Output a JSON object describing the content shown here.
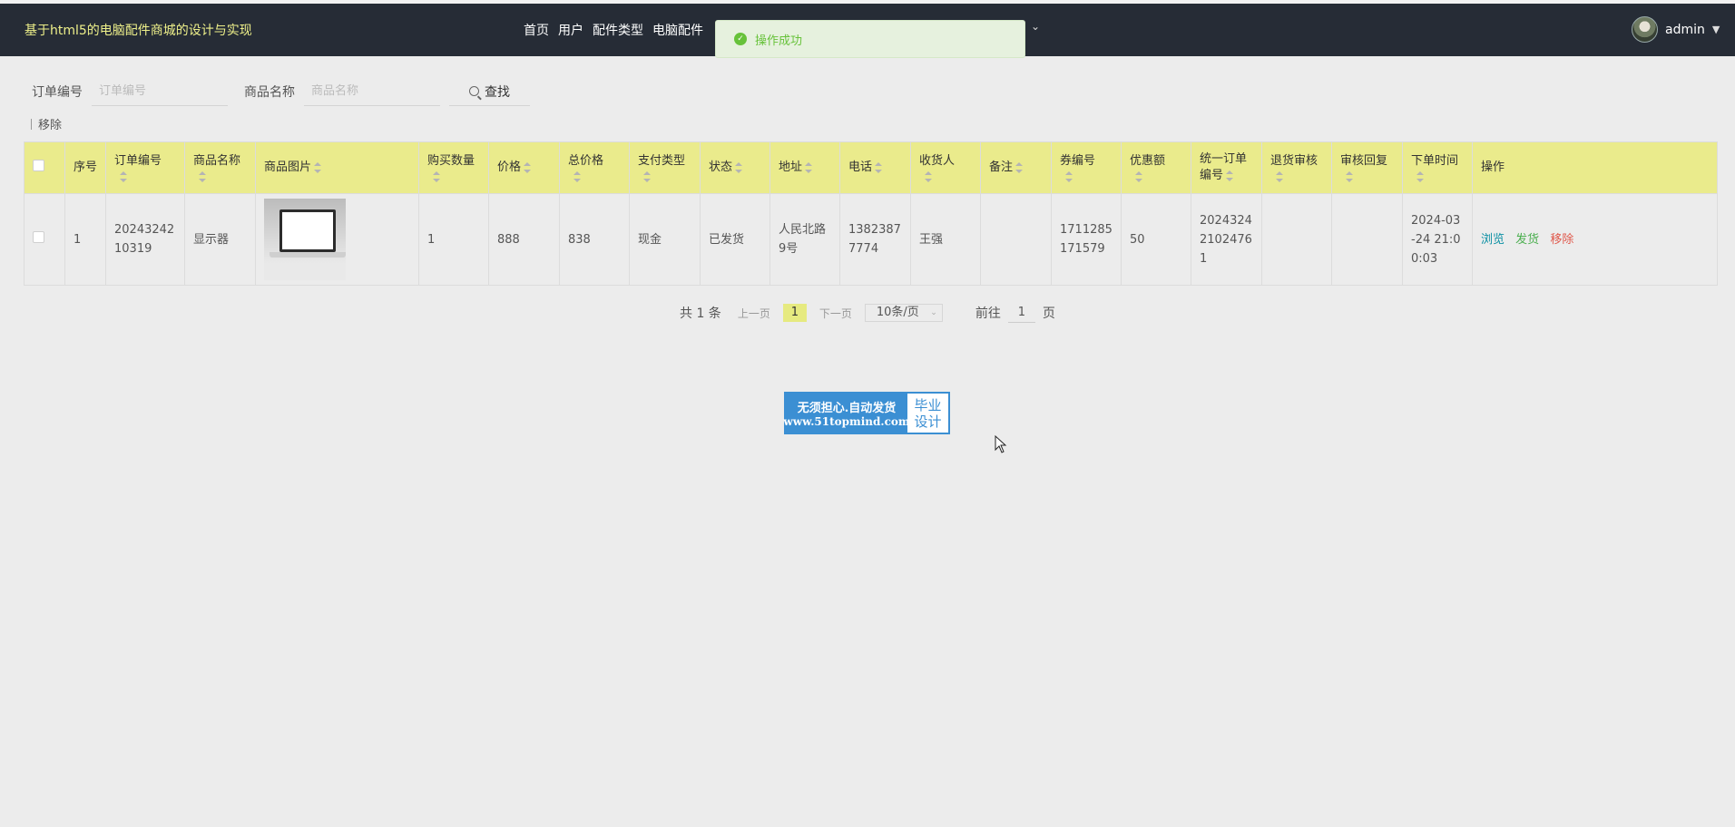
{
  "app": {
    "title": "基于html5的电脑配件商城的设计与实现"
  },
  "nav": {
    "items": [
      "首页",
      "用户",
      "配件类型",
      "电脑配件"
    ],
    "more_caret": "⌄"
  },
  "user": {
    "name": "admin"
  },
  "toast": {
    "message": "操作成功"
  },
  "search": {
    "order_no_label": "订单编号",
    "order_no_placeholder": "订单编号",
    "order_no_value": "",
    "product_label": "商品名称",
    "product_placeholder": "商品名称",
    "product_value": "",
    "button_label": "查找"
  },
  "toolbar": {
    "remove_label": "移除"
  },
  "table": {
    "columns": [
      {
        "key": "index",
        "label": "序号"
      },
      {
        "key": "order_no",
        "label": "订单编号"
      },
      {
        "key": "product",
        "label": "商品名称"
      },
      {
        "key": "image",
        "label": "商品图片"
      },
      {
        "key": "qty",
        "label": "购买数量"
      },
      {
        "key": "price",
        "label": "价格"
      },
      {
        "key": "total",
        "label": "总价格"
      },
      {
        "key": "pay_type",
        "label": "支付类型"
      },
      {
        "key": "status",
        "label": "状态"
      },
      {
        "key": "address",
        "label": "地址"
      },
      {
        "key": "phone",
        "label": "电话"
      },
      {
        "key": "receiver",
        "label": "收货人"
      },
      {
        "key": "remark",
        "label": "备注"
      },
      {
        "key": "coupon_no",
        "label": "券编号"
      },
      {
        "key": "discount",
        "label": "优惠额"
      },
      {
        "key": "unified_order_no",
        "label": "统一订单编号"
      },
      {
        "key": "refund_review",
        "label": "退货审核"
      },
      {
        "key": "review_reply",
        "label": "审核回复"
      },
      {
        "key": "order_time",
        "label": "下单时间"
      },
      {
        "key": "actions",
        "label": "操作"
      }
    ],
    "rows": [
      {
        "index": "1",
        "order_no": "2024324210319",
        "product": "显示器",
        "qty": "1",
        "price": "888",
        "total": "838",
        "pay_type": "现金",
        "status": "已发货",
        "address": "人民北路9号",
        "phone": "13823877774",
        "receiver": "王强",
        "remark": "",
        "coupon_no": "1711285171579",
        "discount": "50",
        "unified_order_no": "202432421024761",
        "refund_review": "",
        "review_reply": "",
        "order_time": "2024-03-24 21:00:03",
        "actions": {
          "view": "浏览",
          "ship": "发货",
          "remove": "移除"
        }
      }
    ]
  },
  "pagination": {
    "total": "共 1 条",
    "prev": "上一页",
    "current_page": "1",
    "next": "下一页",
    "page_size": "10条/页",
    "goto_label": "前往",
    "goto_value": "1",
    "goto_unit": "页"
  },
  "watermark": {
    "line1": "无须担心.自动发货",
    "line2": "www.51topmind.com",
    "right1": "毕业",
    "right2": "设计"
  },
  "colors": {
    "header_bg": "#262c36",
    "brand_text": "#eef08a",
    "table_header_bg": "#eaeb8c",
    "view_link": "#0a8fa3",
    "ship_link": "#4caf50",
    "remove_link": "#e05a4d",
    "toast_success": "#67c23a"
  }
}
